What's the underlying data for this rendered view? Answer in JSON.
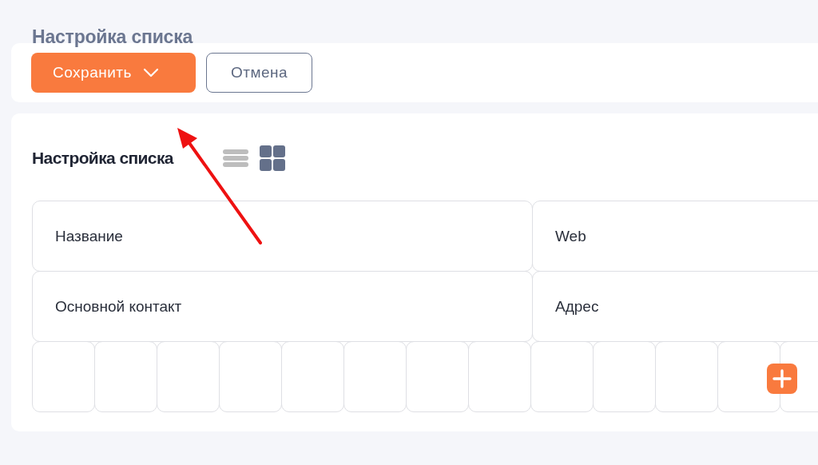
{
  "page_title": "Настройка списка",
  "toolbar": {
    "buttons": [
      {
        "kind": "primary",
        "label": "Сохранить",
        "dropdown": true
      },
      {
        "kind": "secondary",
        "label": "Отмена",
        "dropdown": false
      }
    ]
  },
  "list_settings": {
    "heading": "Настройка списка",
    "view_toggle": [
      {
        "kind": "list",
        "selected": false
      },
      {
        "kind": "grid",
        "selected": true
      }
    ],
    "field_rows": [
      [
        "Название",
        "Web"
      ],
      [
        "Основной контакт",
        "Адрес"
      ]
    ]
  }
}
